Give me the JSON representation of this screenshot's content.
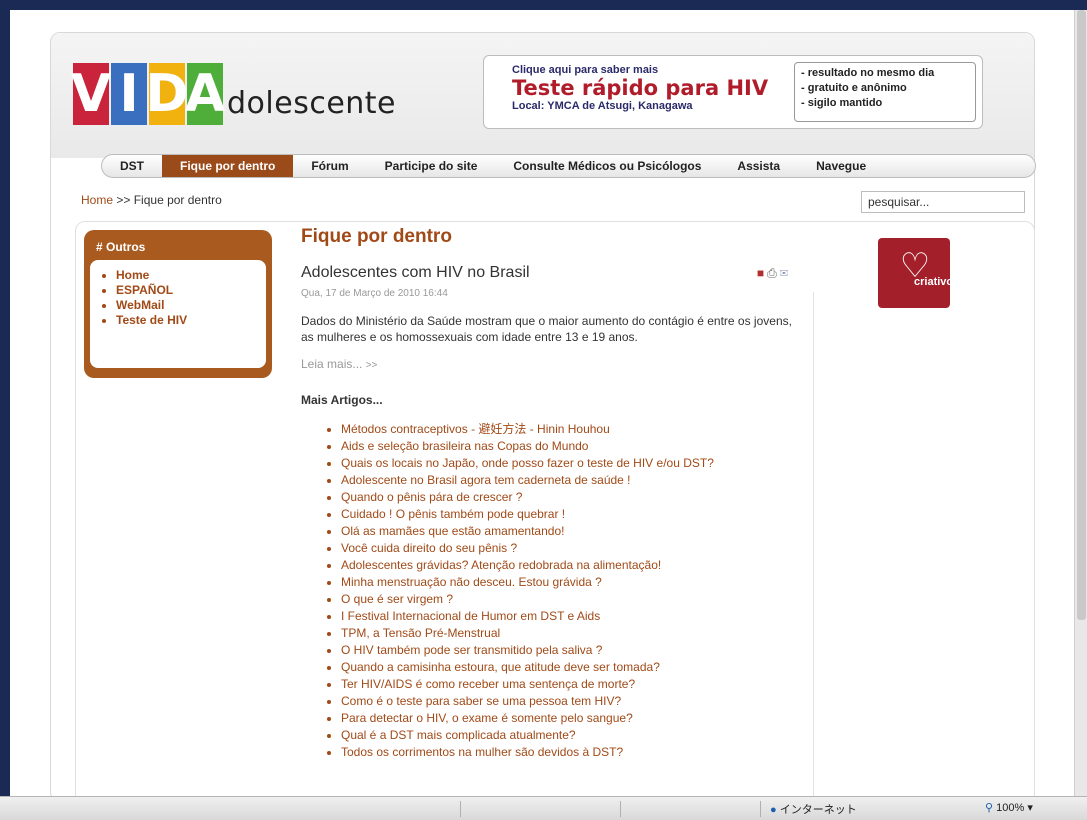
{
  "logo": {
    "letters": [
      {
        "char": "V",
        "color": "#c9243b"
      },
      {
        "char": "I",
        "color": "#3a6fc0"
      },
      {
        "char": "D",
        "color": "#f1b10f"
      },
      {
        "char": "A",
        "color": "#4fae3a"
      }
    ],
    "rest": "dolescente"
  },
  "banner": {
    "small": "Clique aqui para saber mais",
    "big": "Teste rápido para HIV",
    "location": "Local: YMCA de Atsugi, Kanagawa",
    "bullets": [
      "- resultado no mesmo dia",
      "- gratuito e anônimo",
      "- sigilo mantido"
    ]
  },
  "nav": {
    "items": [
      "DST",
      "Fique por dentro",
      "Fórum",
      "Participe do site",
      "Consulte Médicos ou Psicólogos",
      "Assista",
      "Navegue"
    ],
    "active_index": 1
  },
  "breadcrumb": {
    "home": "Home",
    "sep": ">>",
    "current": "Fique por dentro"
  },
  "search": {
    "placeholder": "pesquisar..."
  },
  "outros": {
    "title": "# Outros",
    "items": [
      "Home",
      "ESPAÑOL",
      "WebMail",
      "Teste de HIV"
    ]
  },
  "main": {
    "section_title": "Fique por dentro",
    "article_title": "Adolescentes com HIV no Brasil",
    "article_date": "Qua, 17 de Março de 2010 16:44",
    "article_body": "Dados do Ministério da Saúde mostram que o maior aumento do contágio é entre os jovens, as mulheres e os homossexuais com idade entre 13 e 19 anos.",
    "read_more": "Leia mais...",
    "read_more_arrow": ">>",
    "mais_artigos": "Mais Artigos...",
    "links": [
      "Métodos contraceptivos - 避妊方法 - Hinin Houhou",
      "Aids e seleção brasileira nas Copas do Mundo",
      "Quais os locais no Japão, onde posso fazer o teste de HIV e/ou DST?",
      "Adolescente no Brasil agora tem caderneta de saúde !",
      "Quando o pênis pára de crescer ?",
      "Cuidado ! O pênis também pode quebrar !",
      "Olá as mamães que estão amamentando!",
      "Você cuida direito do seu pênis ?",
      "Adolescentes grávidas? Atenção redobrada na alimentação!",
      "Minha menstruação não desceu. Estou grávida ?",
      "O que é ser virgem ?",
      "I Festival Internacional de Humor em DST e Aids",
      "TPM, a Tensão Pré-Menstrual",
      "O HIV também pode ser transmitido pela saliva ?",
      "Quando a camisinha estoura, que atitude deve ser tomada?",
      "Ter HIV/AIDS é como receber uma sentença de morte?",
      "Como é o teste para saber se uma pessoa tem HIV?",
      "Para detectar o HIV, o exame é somente pelo sangue?",
      "Qual é a DST mais complicada atualmente?",
      "Todos os corrimentos na mulher são devidos à DST?"
    ]
  },
  "side": {
    "logo_text": "criativos"
  },
  "status": {
    "zone": "インターネット",
    "zoom": "100%"
  },
  "colors": {
    "accent": "#a14a17",
    "nav_active": "#9b4a1a",
    "outros_bg": "#a85a1f"
  }
}
